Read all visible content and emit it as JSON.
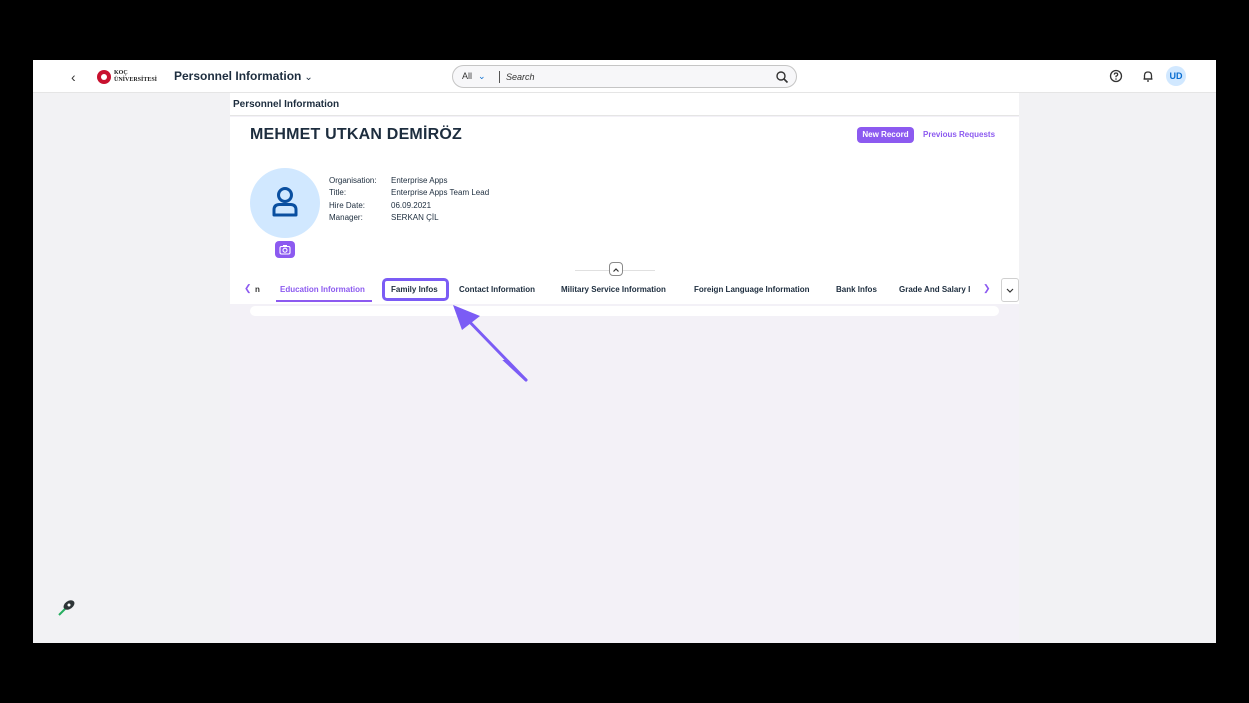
{
  "shell": {
    "back_icon": "chevron-left-icon",
    "logo_text": "KOÇ\nÜNİVERSİTESİ",
    "app_title": "Personnel Information",
    "search": {
      "scope": "All",
      "placeholder": "Search"
    },
    "avatar_initials": "UD",
    "accent_color": "#8c5af0"
  },
  "page": {
    "heading": "Personnel Information",
    "employee": {
      "name": "MEHMET UTKAN DEMİRÖZ",
      "attributes": [
        {
          "label": "Organisation:",
          "value": "Enterprise Apps"
        },
        {
          "label": "Title:",
          "value": "Enterprise Apps Team Lead"
        },
        {
          "label": "Hire Date:",
          "value": "06.09.2021"
        },
        {
          "label": "Manager:",
          "value": "SERKAN ÇİL"
        }
      ]
    },
    "actions": {
      "new_record": "New Record",
      "previous_requests": "Previous Requests"
    },
    "tabs": {
      "partial_prev": "n",
      "items": [
        {
          "label": "Education Information",
          "selected": true
        },
        {
          "label": "Family Infos",
          "highlighted": true
        },
        {
          "label": "Contact Information"
        },
        {
          "label": "Military Service Information"
        },
        {
          "label": "Foreign Language Information"
        },
        {
          "label": "Bank Infos"
        },
        {
          "label": "Grade And Salary I"
        }
      ]
    }
  }
}
